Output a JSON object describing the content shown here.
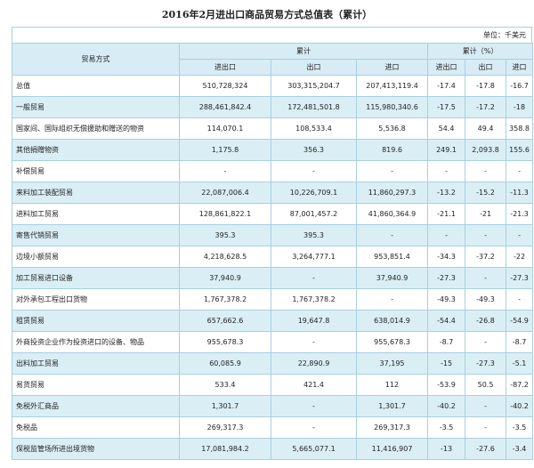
{
  "title": "2016年2月进出口商品贸易方式总值表（累计）",
  "unit": "单位：千美元",
  "headers": {
    "mode": "贸易方式",
    "cumulative": "累计",
    "cumulative_pct": "累计（%）",
    "total": "进出口",
    "export": "出口",
    "import": "进口",
    "pct_total": "进出口",
    "pct_export": "出口",
    "pct_import": "进口"
  },
  "rows": [
    {
      "name": "总值",
      "total": "510,728,324",
      "export": "303,315,204.7",
      "import": "207,413,119.4",
      "pt": "-17.4",
      "pe": "-17.8",
      "pi": "-16.7"
    },
    {
      "name": "一般贸易",
      "total": "288,461,842.4",
      "export": "172,481,501.8",
      "import": "115,980,340.6",
      "pt": "-17.5",
      "pe": "-17.2",
      "pi": "-18"
    },
    {
      "name": "国家间、国际组织无偿援助和赠送的物资",
      "total": "114,070.1",
      "export": "108,533.4",
      "import": "5,536.8",
      "pt": "54.4",
      "pe": "49.4",
      "pi": "358.8"
    },
    {
      "name": "其他捐赠物资",
      "total": "1,175.8",
      "export": "356.3",
      "import": "819.6",
      "pt": "249.1",
      "pe": "2,093.8",
      "pi": "155.6"
    },
    {
      "name": "补偿贸易",
      "total": "-",
      "export": "-",
      "import": "-",
      "pt": "-",
      "pe": "-",
      "pi": "-"
    },
    {
      "name": "来料加工装配贸易",
      "total": "22,087,006.4",
      "export": "10,226,709.1",
      "import": "11,860,297.3",
      "pt": "-13.2",
      "pe": "-15.2",
      "pi": "-11.3"
    },
    {
      "name": "进料加工贸易",
      "total": "128,861,822.1",
      "export": "87,001,457.2",
      "import": "41,860,364.9",
      "pt": "-21.1",
      "pe": "-21",
      "pi": "-21.3"
    },
    {
      "name": "寄售代销贸易",
      "total": "395.3",
      "export": "395.3",
      "import": "-",
      "pt": "-",
      "pe": "-",
      "pi": "-"
    },
    {
      "name": "边境小额贸易",
      "total": "4,218,628.5",
      "export": "3,264,777.1",
      "import": "953,851.4",
      "pt": "-34.3",
      "pe": "-37.2",
      "pi": "-22"
    },
    {
      "name": "加工贸易进口设备",
      "total": "37,940.9",
      "export": "-",
      "import": "37,940.9",
      "pt": "-27.3",
      "pe": "-",
      "pi": "-27.3"
    },
    {
      "name": "对外承包工程出口货物",
      "total": "1,767,378.2",
      "export": "1,767,378.2",
      "import": "-",
      "pt": "-49.3",
      "pe": "-49.3",
      "pi": "-"
    },
    {
      "name": "租赁贸易",
      "total": "657,662.6",
      "export": "19,647.8",
      "import": "638,014.9",
      "pt": "-54.4",
      "pe": "-26.8",
      "pi": "-54.9"
    },
    {
      "name": "外商投资企业作为投资进口的设备、物品",
      "total": "955,678.3",
      "export": "-",
      "import": "955,678.3",
      "pt": "-8.7",
      "pe": "-",
      "pi": "-8.7"
    },
    {
      "name": "出料加工贸易",
      "total": "60,085.9",
      "export": "22,890.9",
      "import": "37,195",
      "pt": "-15",
      "pe": "-27.3",
      "pi": "-5.1"
    },
    {
      "name": "易货贸易",
      "total": "533.4",
      "export": "421.4",
      "import": "112",
      "pt": "-53.9",
      "pe": "50.5",
      "pi": "-87.2"
    },
    {
      "name": "免税外汇商品",
      "total": "1,301.7",
      "export": "-",
      "import": "1,301.7",
      "pt": "-40.2",
      "pe": "-",
      "pi": "-40.2"
    },
    {
      "name": "免税品",
      "total": "269,317.3",
      "export": "-",
      "import": "269,317.3",
      "pt": "-3.5",
      "pe": "-",
      "pi": "-3.5"
    },
    {
      "name": "保税监管场所进出境货物",
      "total": "17,081,984.2",
      "export": "5,665,077.1",
      "import": "11,416,907",
      "pt": "-13",
      "pe": "-27.6",
      "pi": "-3.4"
    }
  ]
}
